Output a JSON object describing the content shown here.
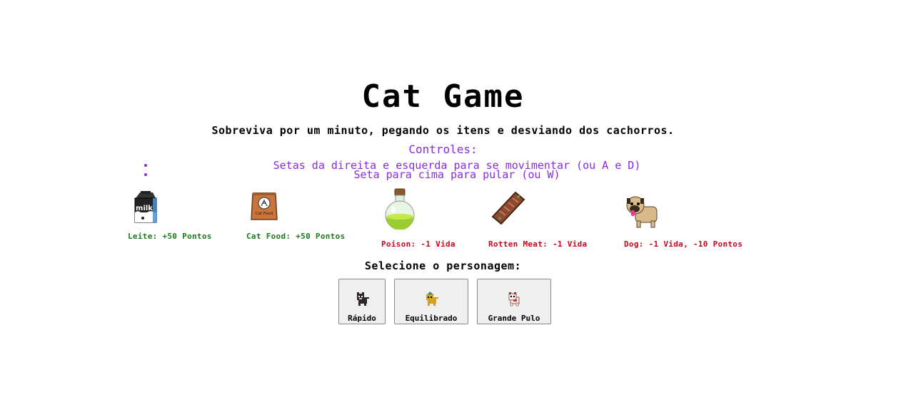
{
  "title": "Cat Game",
  "subtitle": "Sobreviva por um minuto, pegando os itens e desviando dos cachorros.",
  "controls": {
    "heading": "Controles:",
    "items": [
      "Setas da direita e esquerda para se movimentar (ou A e D)",
      "Seta para cima para pular (ou W)"
    ]
  },
  "items": [
    {
      "name": "milk-icon",
      "label": "Leite: +50 Pontos",
      "type": "good"
    },
    {
      "name": "cat-food-icon",
      "label": "Cat Food: +50 Pontos",
      "type": "good",
      "bag_text": "Cat Food"
    },
    {
      "name": "poison-icon",
      "label": "Poison: -1 Vida",
      "type": "bad"
    },
    {
      "name": "rotten-meat-icon",
      "label": "Rotten Meat: -1 Vida",
      "type": "bad"
    },
    {
      "name": "dog-icon",
      "label": "Dog: -1 Vida, -10 Pontos",
      "type": "bad"
    }
  ],
  "milk_carton_text": "milk",
  "character_select": {
    "heading": "Selecione o personagem:",
    "options": [
      {
        "label": "Rápido"
      },
      {
        "label": "Equilibrado"
      },
      {
        "label": "Grande Pulo"
      }
    ]
  },
  "colors": {
    "accent_purple": "#8a2be2",
    "good_green": "#1a7a1a",
    "bad_red": "#d0021b"
  }
}
